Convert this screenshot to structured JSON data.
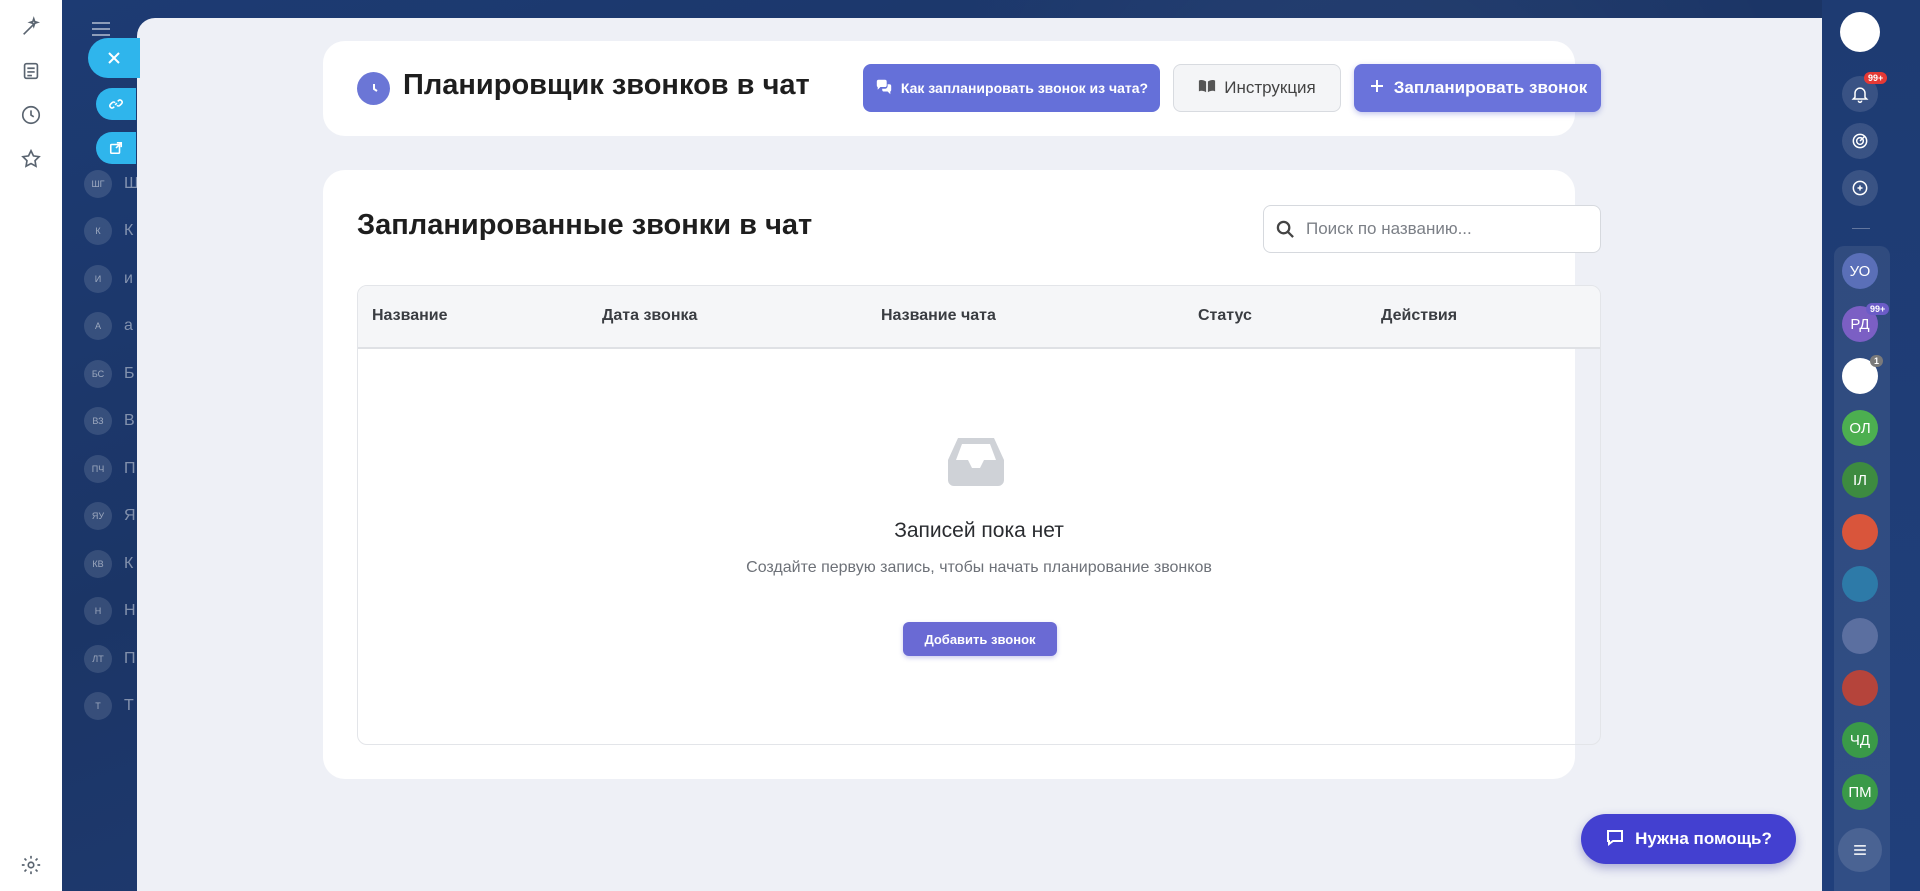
{
  "header": {
    "title": "Планировщик звонков в чат",
    "howto_button": "Как запланировать звонок из чата?",
    "instruction_button": "Инструкция",
    "schedule_button": "Запланировать звонок"
  },
  "main": {
    "section_title": "Запланированные звонки в чат",
    "search_placeholder": "Поиск по названию...",
    "columns": [
      "Название",
      "Дата звонка",
      "Название чата",
      "Статус",
      "Действия"
    ],
    "empty_title": "Записей пока нет",
    "empty_subtitle": "Создайте первую запись, чтобы начать планирование звонков",
    "add_button": "Добавить звонок"
  },
  "help_button": "Нужна помощь?",
  "background": {
    "chat_avatars": [
      "ШГ",
      "К",
      "И",
      "А",
      "БС",
      "ВЗ",
      "ПЧ",
      "ЯУ",
      "КВ",
      "Н",
      "ЛТ",
      "Т"
    ],
    "chat_letters": [
      "Ш",
      "К",
      "и",
      "а",
      "Б",
      "В",
      "П",
      "Я",
      "К",
      "Н",
      "П",
      "Т"
    ]
  },
  "right_rail": {
    "notifications_badge": "99+",
    "avatars": [
      {
        "initials": "УО",
        "color": "#5a6fb8"
      },
      {
        "initials": "РД",
        "color": "#7b5fc4",
        "badge": "99+"
      },
      {
        "initials": "",
        "color": "#ffffff",
        "badge": "1"
      },
      {
        "initials": "ОЛ",
        "color": "#4caf50"
      },
      {
        "initials": "ІЛ",
        "color": "#3d8b40"
      },
      {
        "initials": "",
        "color": "#d9553b"
      },
      {
        "initials": "",
        "color": "#2d7aa8"
      },
      {
        "initials": "",
        "color": "#5b6fa0"
      },
      {
        "initials": "",
        "color": "#b5443b"
      },
      {
        "initials": "ЧД",
        "color": "#3a9a48"
      },
      {
        "initials": "ПМ",
        "color": "#3a9a48"
      }
    ]
  },
  "colors": {
    "accent": "#6570d9",
    "help": "#4340d0",
    "overlay_bg": "#eef0f6",
    "side_button": "#2fb5ec"
  }
}
